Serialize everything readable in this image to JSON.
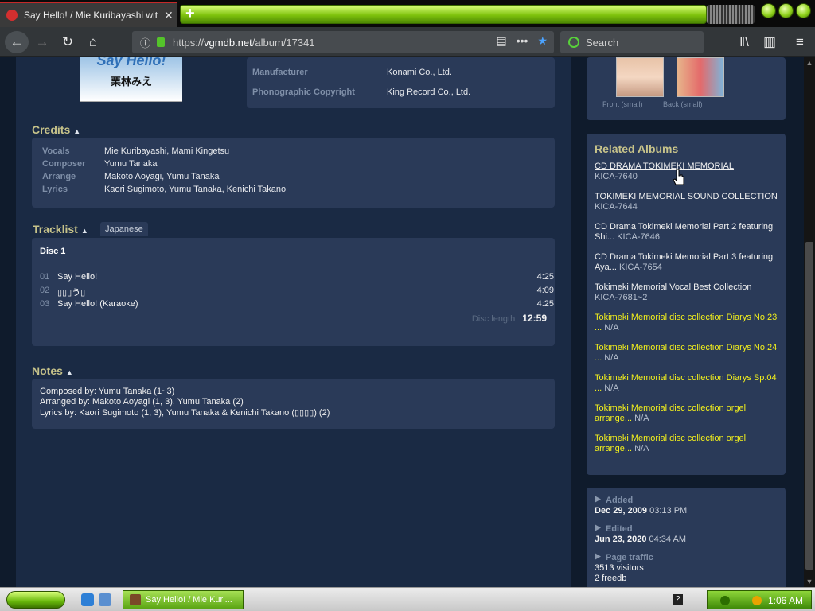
{
  "browser": {
    "tab_title": "Say Hello! / Mie Kuribayashi with S",
    "url_prefix": "https://",
    "url_domain": "vgmdb.net",
    "url_path": "/album/17341",
    "search_placeholder": "Search"
  },
  "album": {
    "cover_title": "Say Hello!",
    "cover_subtitle": "栗林みえ",
    "info": [
      {
        "label": "Manufacturer",
        "value": "Konami Co., Ltd."
      },
      {
        "label": "Phonographic Copyright",
        "value": "King Record Co., Ltd."
      }
    ],
    "credits_title": "Credits",
    "credits": [
      {
        "label": "Vocals",
        "value": "Mie Kuribayashi, Mami Kingetsu"
      },
      {
        "label": "Composer",
        "value": "Yumu Tanaka"
      },
      {
        "label": "Arrange",
        "value": "Makoto Aoyagi, Yumu Tanaka"
      },
      {
        "label": "Lyrics",
        "value": "Kaori Sugimoto, Yumu Tanaka, Kenichi Takano"
      }
    ],
    "tracklist_title": "Tracklist",
    "tracklist_lang_tab": "Japanese",
    "disc_label": "Disc 1",
    "tracks": [
      {
        "num": "01",
        "title": "Say Hello!",
        "time": "4:25"
      },
      {
        "num": "02",
        "title": "▯▯▯う▯",
        "time": "4:09"
      },
      {
        "num": "03",
        "title": "Say Hello! (Karaoke)",
        "time": "4:25"
      }
    ],
    "disc_length_label": "Disc length",
    "disc_length_value": "12:59",
    "notes_title": "Notes",
    "notes": [
      "Composed by: Yumu Tanaka (1~3)",
      "Arranged by: Makoto Aoyagi (1, 3), Yumu Tanaka (2)",
      "Lyrics by: Kaori Sugimoto (1, 3), Yumu Tanaka & Kenichi Takano (▯▯▯▯) (2)"
    ]
  },
  "sidebar": {
    "covers": [
      {
        "caption": "Front (small)"
      },
      {
        "caption": "Back (small)"
      }
    ],
    "related_title": "Related Albums",
    "related": [
      {
        "name": "CD DRAMA TOKIMEKI MEMORIAL",
        "catalog": "KICA-7640"
      },
      {
        "name": "TOKIMEKI MEMORIAL SOUND COLLECTION",
        "catalog": "KICA-7644"
      },
      {
        "name": "CD Drama Tokimeki Memorial Part 2 featuring Shi...",
        "catalog": "KICA-7646"
      },
      {
        "name": "CD Drama Tokimeki Memorial Part 3 featuring Aya...",
        "catalog": "KICA-7654"
      },
      {
        "name": "Tokimeki Memorial Vocal Best Collection",
        "catalog": "KICA-7681~2"
      },
      {
        "name": "Tokimeki Memorial disc collection Diarys No.23 ...",
        "catalog": "N/A"
      },
      {
        "name": "Tokimeki Memorial disc collection Diarys No.24 ...",
        "catalog": "N/A"
      },
      {
        "name": "Tokimeki Memorial disc collection Diarys Sp.04 ...",
        "catalog": "N/A"
      },
      {
        "name": "Tokimeki Memorial disc collection orgel arrange...",
        "catalog": "N/A"
      },
      {
        "name": "Tokimeki Memorial disc collection orgel arrange...",
        "catalog": "N/A"
      }
    ],
    "added_label": "Added",
    "added_date": "Dec 29, 2009",
    "added_time": "03:13 PM",
    "edited_label": "Edited",
    "edited_date": "Jun 23, 2020",
    "edited_time": "04:34 AM",
    "traffic_label": "Page traffic",
    "traffic_visitors": "3513 visitors",
    "traffic_freedb": "2 freedb"
  },
  "taskbar": {
    "task_label": "Say Hello! / Mie Kuri...",
    "clock": "1:06 AM"
  },
  "colors": {
    "page_bg": "#1a2a44",
    "panel_bg": "#2a3a58",
    "heading": "#c7c38a",
    "yellow_link": "#f2ef1c"
  }
}
